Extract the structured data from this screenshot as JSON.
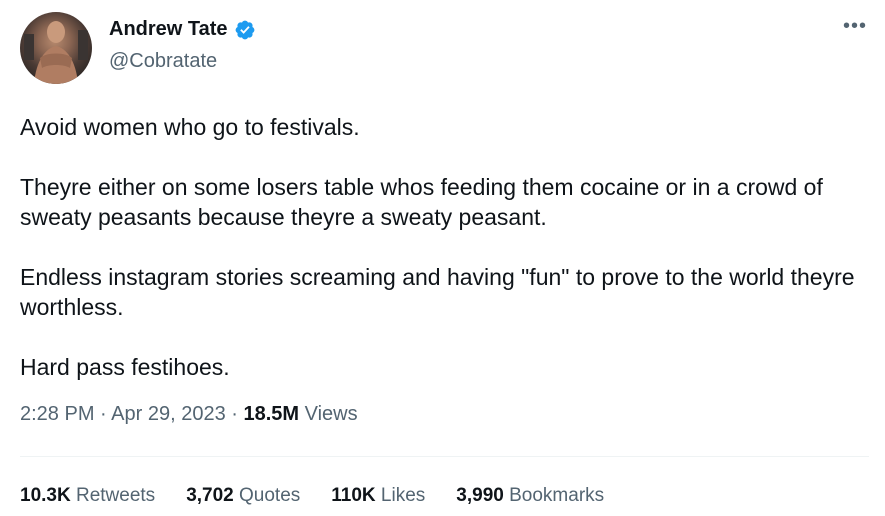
{
  "user": {
    "display_name": "Andrew Tate",
    "handle": "@Cobratate",
    "verified": true,
    "verified_color": "#1d9bf0"
  },
  "icons": {
    "avatar": "profile-photo",
    "verified": "verified-badge-icon",
    "more": "more-options-icon"
  },
  "more_glyph": "•••",
  "tweet": {
    "paragraphs": [
      "Avoid women who go to festivals.",
      "Theyre either on some losers table whos feeding them cocaine or in a crowd of sweaty peasants because theyre a sweaty peasant.",
      "Endless instagram stories screaming and having \"fun\" to prove to the world theyre worthless.",
      "Hard pass festihoes."
    ]
  },
  "meta": {
    "time": "2:28 PM",
    "separator": " · ",
    "date": "Apr 29, 2023",
    "views_count": "18.5M",
    "views_label": " Views"
  },
  "stats": [
    {
      "count": "10.3K",
      "label": " Retweets"
    },
    {
      "count": "3,702",
      "label": " Quotes"
    },
    {
      "count": "110K",
      "label": " Likes"
    },
    {
      "count": "3,990",
      "label": " Bookmarks"
    }
  ]
}
